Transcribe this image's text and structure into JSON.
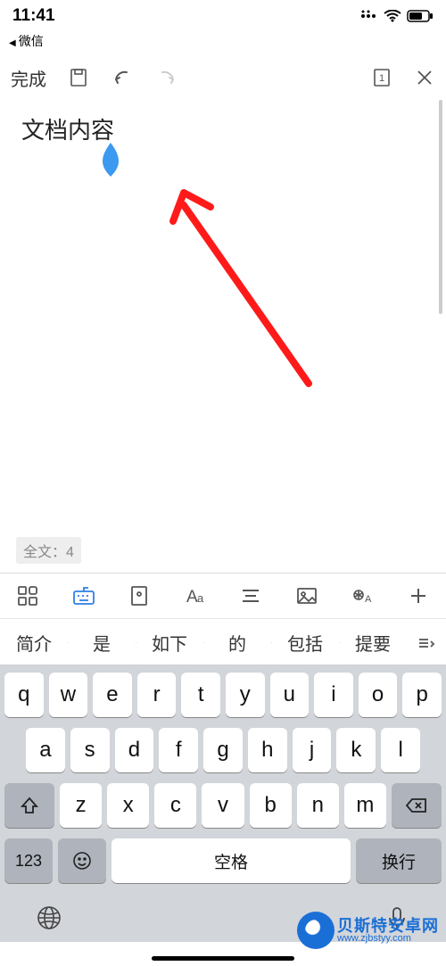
{
  "status": {
    "time": "11:41",
    "back_app": "微信"
  },
  "toolbar": {
    "done": "完成",
    "page_count": "1"
  },
  "document": {
    "content": "文档内容",
    "word_count_label": "全文：4"
  },
  "format_icons": [
    "grid",
    "keyboard",
    "view",
    "font",
    "align",
    "image",
    "voice",
    "plus"
  ],
  "suggestions": [
    "简介",
    "是",
    "如下",
    "的",
    "包括",
    "提要"
  ],
  "keyboard": {
    "row1": [
      "q",
      "w",
      "e",
      "r",
      "t",
      "y",
      "u",
      "i",
      "o",
      "p"
    ],
    "row2": [
      "a",
      "s",
      "d",
      "f",
      "g",
      "h",
      "j",
      "k",
      "l"
    ],
    "row3": [
      "z",
      "x",
      "c",
      "v",
      "b",
      "n",
      "m"
    ],
    "num": "123",
    "space": "空格",
    "enter": "换行"
  },
  "watermark": {
    "title": "贝斯特安卓网",
    "url": "www.zjbstyy.com"
  }
}
